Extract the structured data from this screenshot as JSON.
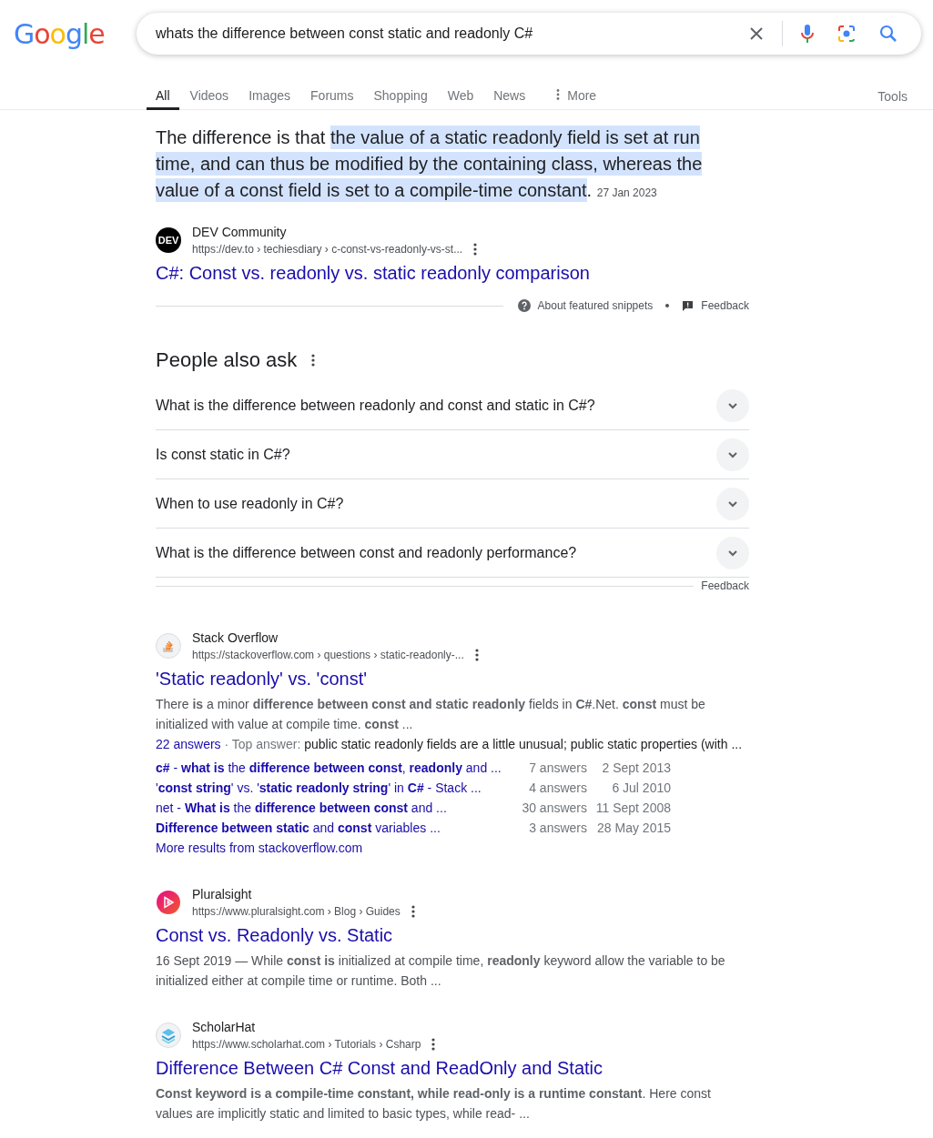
{
  "logo": "Google",
  "search": {
    "value": "whats the difference between const static and readonly C#"
  },
  "tabs": [
    {
      "label": "All",
      "selected": true
    },
    {
      "label": "Videos",
      "selected": false
    },
    {
      "label": "Images",
      "selected": false
    },
    {
      "label": "Forums",
      "selected": false
    },
    {
      "label": "Shopping",
      "selected": false
    },
    {
      "label": "Web",
      "selected": false
    },
    {
      "label": "News",
      "selected": false
    },
    {
      "label": "More",
      "selected": false,
      "kind": "menu"
    }
  ],
  "tools": "Tools",
  "featured": {
    "lead": "The difference is that ",
    "highlight": "the value of a static readonly field is set at run time, and can thus be modified by the containing class, whereas the value of a const field is set to a compile-time constant",
    "tail": ".",
    "date": "27 Jan 2023",
    "source": {
      "site": "DEV Community",
      "favicon_text": "DEV",
      "url": "https://dev.to › techiesdiary › c-const-vs-readonly-vs-st...",
      "title": "C#: Const vs. readonly vs. static readonly comparison"
    },
    "about": "About featured snippets",
    "feedback": "Feedback"
  },
  "people_also_ask": {
    "title": "People also ask",
    "questions": [
      {
        "text": "What is the difference between readonly and const and static in C#?",
        "expanded": false
      },
      {
        "text": "Is const static in C#?",
        "expanded": false
      },
      {
        "text": "When to use readonly in C#?",
        "expanded": false
      },
      {
        "text": "What is the difference between const and readonly performance?",
        "expanded": false
      }
    ],
    "feedback": "Feedback"
  },
  "results": [
    {
      "site": "Stack Overflow",
      "url": "https://stackoverflow.com › questions › static-readonly-...",
      "title": "'Static readonly' vs. 'const'",
      "snippet": "There **is** a minor **difference between const and static readonly** fields in **C#**.Net. **const** must be initialized with value at compile time. **const** ...",
      "answers_link": "22 answers",
      "answers_label": " · Top answer: ",
      "top_answer": "public static readonly fields are a little unusual; public static properties (with ...",
      "related": [
        {
          "title": "**c#** - **what is** the **difference between const**, **readonly** and ...",
          "answers": "7 answers",
          "date": "2 Sept 2013"
        },
        {
          "title": "'**const string**' vs. '**static readonly string**' in **C#** - Stack ...",
          "answers": "4 answers",
          "date": "6 Jul 2010"
        },
        {
          "title": "net - **What is** the **difference between const** and ...",
          "answers": "30 answers",
          "date": "11 Sept 2008"
        },
        {
          "title": "**Difference between static** and **const** variables ...",
          "answers": "3 answers",
          "date": "28 May 2015"
        }
      ],
      "more": "More results from stackoverflow.com"
    },
    {
      "site": "Pluralsight",
      "url": "https://www.pluralsight.com › Blog › Guides",
      "title": "Const vs. Readonly vs. Static",
      "date": "16 Sept 2019 — ",
      "snippet": "While **const is** initialized at compile time, **readonly** keyword allow the variable to be initialized either at compile time or runtime. Both ..."
    },
    {
      "site": "ScholarHat",
      "url": "https://www.scholarhat.com › Tutorials › Csharp",
      "title": "Difference Between C# Const and ReadOnly and Static",
      "snippet": "**Const keyword is a compile-time constant, while read-only is a runtime constant**. Here const values are implicitly static and limited to basic types, while read- ..."
    }
  ]
}
